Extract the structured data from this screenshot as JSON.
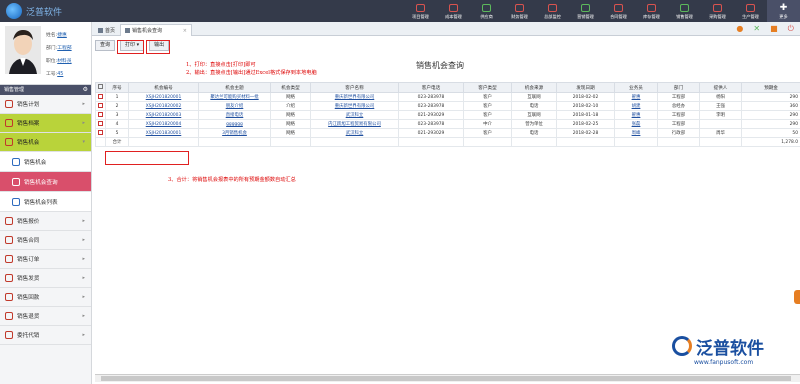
{
  "app": {
    "logo_text": "泛普软件"
  },
  "topnav": [
    {
      "label": "项目管理",
      "icon": "project-icon"
    },
    {
      "label": "成本管理",
      "icon": "cost-icon"
    },
    {
      "label": "供应商",
      "icon": "supplier-icon"
    },
    {
      "label": "财务管理",
      "icon": "finance-icon"
    },
    {
      "label": "总部监控",
      "icon": "monitor-icon"
    },
    {
      "label": "营销管理",
      "icon": "marketing-icon"
    },
    {
      "label": "合同管理",
      "icon": "contract-icon"
    },
    {
      "label": "库存管理",
      "icon": "inventory-icon"
    },
    {
      "label": "销售管理",
      "icon": "sales-icon"
    },
    {
      "label": "采购管理",
      "icon": "purchase-icon"
    },
    {
      "label": "生产管理",
      "icon": "production-icon"
    },
    {
      "label": "更多",
      "icon": "more-icon"
    }
  ],
  "tabs": {
    "home": "首页",
    "active": "销售机会查询",
    "close": "×"
  },
  "user": {
    "name_label": "姓名:",
    "name": "捷惠",
    "dept_label": "部门:",
    "dept": "工程部",
    "role_label": "职位:",
    "role": "材料员",
    "id_label": "工号:",
    "id": "45"
  },
  "sidebar": {
    "title": "销售管理",
    "items": [
      {
        "label": "销售计划",
        "type": "group"
      },
      {
        "label": "销售档案",
        "type": "group"
      },
      {
        "label": "销售机会",
        "type": "open"
      },
      {
        "label": "销售机会",
        "type": "sub"
      },
      {
        "label": "销售机会查询",
        "type": "active"
      },
      {
        "label": "销售机会列表",
        "type": "sub"
      },
      {
        "label": "销售报价",
        "type": "group"
      },
      {
        "label": "销售合同",
        "type": "group"
      },
      {
        "label": "销售订单",
        "type": "group"
      },
      {
        "label": "销售发货",
        "type": "group"
      },
      {
        "label": "销售回款",
        "type": "group"
      },
      {
        "label": "销售退货",
        "type": "group"
      },
      {
        "label": "委托代销",
        "type": "group"
      }
    ]
  },
  "toolbar": {
    "query": "查询",
    "print": "打印",
    "export": "输出"
  },
  "notes": {
    "n1": "1、打印：直接点击[打印]即可",
    "n2": "2、输出：直接点击[输出]通过Excel格式保存到本地电脑",
    "n3": "3、合计：将销售机会报表中的所有预期金额数自动汇总"
  },
  "page_title": "销售机会查询",
  "table": {
    "headers": [
      "",
      "序号",
      "机会编号",
      "机会主题",
      "机会类型",
      "客户名称",
      "客户电话",
      "客户类型",
      "机会来源",
      "发现日期",
      "业务员",
      "部门",
      "提供人",
      "预期金"
    ],
    "rows": [
      [
        "1",
        "XSJH201820001",
        "聚达兰可能购买材料一批",
        "网络",
        "重庆新世界有限公司",
        "023-283978",
        "客户",
        "互联网",
        "2018-02-02",
        "翟惠",
        "工程部",
        "杨阳",
        "290"
      ],
      [
        "2",
        "XSJH201820002",
        "朋友介绍",
        "介绍",
        "重庆新世界有限公司",
        "023-283978",
        "客户",
        "电话",
        "2018-02-10",
        "胡建",
        "总经办",
        "王强",
        "360"
      ],
      [
        "3",
        "XSJH201820003",
        "直接电话",
        "网络",
        "武汉科立",
        "021-293029",
        "客户",
        "互联网",
        "2018-01-18",
        "翟惠",
        "工程部",
        "李明",
        "290"
      ],
      [
        "4",
        "XSJH201820004",
        "gggggg",
        "网络",
        "内江跃旭工程贸易有限公司",
        "023-283978",
        "中介",
        "营为单位",
        "2018-02-25",
        "张磊",
        "工程部",
        "",
        "290"
      ],
      [
        "5",
        "XSJH201830001",
        "3月销售机会",
        "网络",
        "武汉科立",
        "021-293029",
        "客户",
        "电话",
        "2018-02-28",
        "周峰",
        "行政部",
        "周华",
        "50"
      ]
    ],
    "total_label": "合计",
    "total_value": "1,278.0"
  },
  "brand": {
    "name": "泛普软件",
    "url": "www.fanpusoft.com"
  }
}
